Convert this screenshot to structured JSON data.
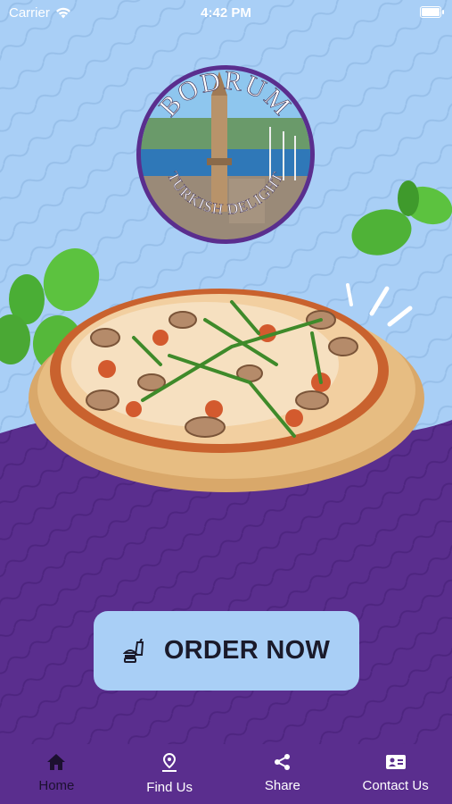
{
  "status_bar": {
    "carrier": "Carrier",
    "time": "4:42 PM"
  },
  "logo": {
    "top_text": "BODRUM",
    "bottom_text": "TURKISH DELIGHT"
  },
  "order_button": {
    "label": "ORDER NOW",
    "icon": "fast-food-icon"
  },
  "tabs": [
    {
      "label": "Home",
      "icon": "home-icon",
      "active": true
    },
    {
      "label": "Find Us",
      "icon": "location-pin-icon",
      "active": false
    },
    {
      "label": "Share",
      "icon": "share-icon",
      "active": false
    },
    {
      "label": "Contact Us",
      "icon": "contact-card-icon",
      "active": false
    }
  ],
  "colors": {
    "top_bg": "#a9cff6",
    "bottom_bg": "#5a2e8e",
    "button_bg": "#a9cff6"
  }
}
